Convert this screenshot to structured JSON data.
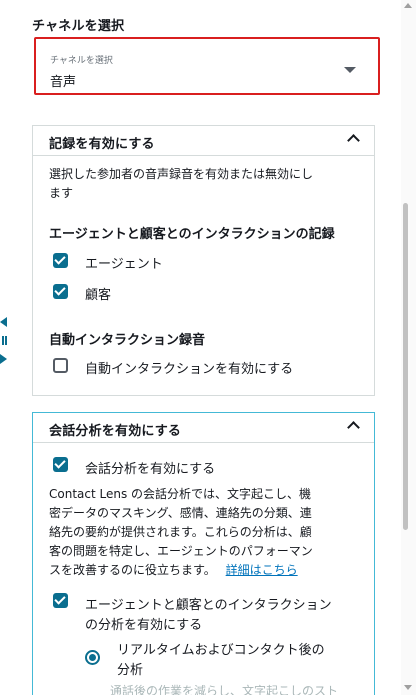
{
  "channel": {
    "label": "チャネルを選択",
    "select_small_label": "チャネルを選択",
    "select_value": "音声"
  },
  "recording": {
    "title": "記録を有効にする",
    "description_line1": "選択した参加者の音声録音を有効または無効にし",
    "description_line2": "ます",
    "interaction_title": "エージェントと顧客とのインタラクションの記録",
    "agent_label": "エージェント",
    "customer_label": "顧客",
    "auto_title": "自動インタラクション録音",
    "auto_label": "自動インタラクションを有効にする"
  },
  "analytics": {
    "title": "会話分析を有効にする",
    "enable_label": "会話分析を有効にする",
    "desc_line1": "Contact Lens の会話分析では、文字起こし、機",
    "desc_line2": "密データのマスキング、感情、連絡先の分類、連",
    "desc_line3": "絡先の要約が提供されます。これらの分析は、顧",
    "desc_line4": "客の問題を特定し、エージェントのパフォーマン",
    "desc_line5": "スを改善するのに役立ちます。",
    "details_link": "詳細はこちら",
    "interaction_line1": "エージェントと顧客とのインタラクション",
    "interaction_line2": "の分析を有効にする",
    "realtime_line1": "リアルタイムおよびコンタクト後の",
    "realtime_line2": "分析",
    "faded_text": "通話後の作業を減らし、文字起こしのスト"
  }
}
